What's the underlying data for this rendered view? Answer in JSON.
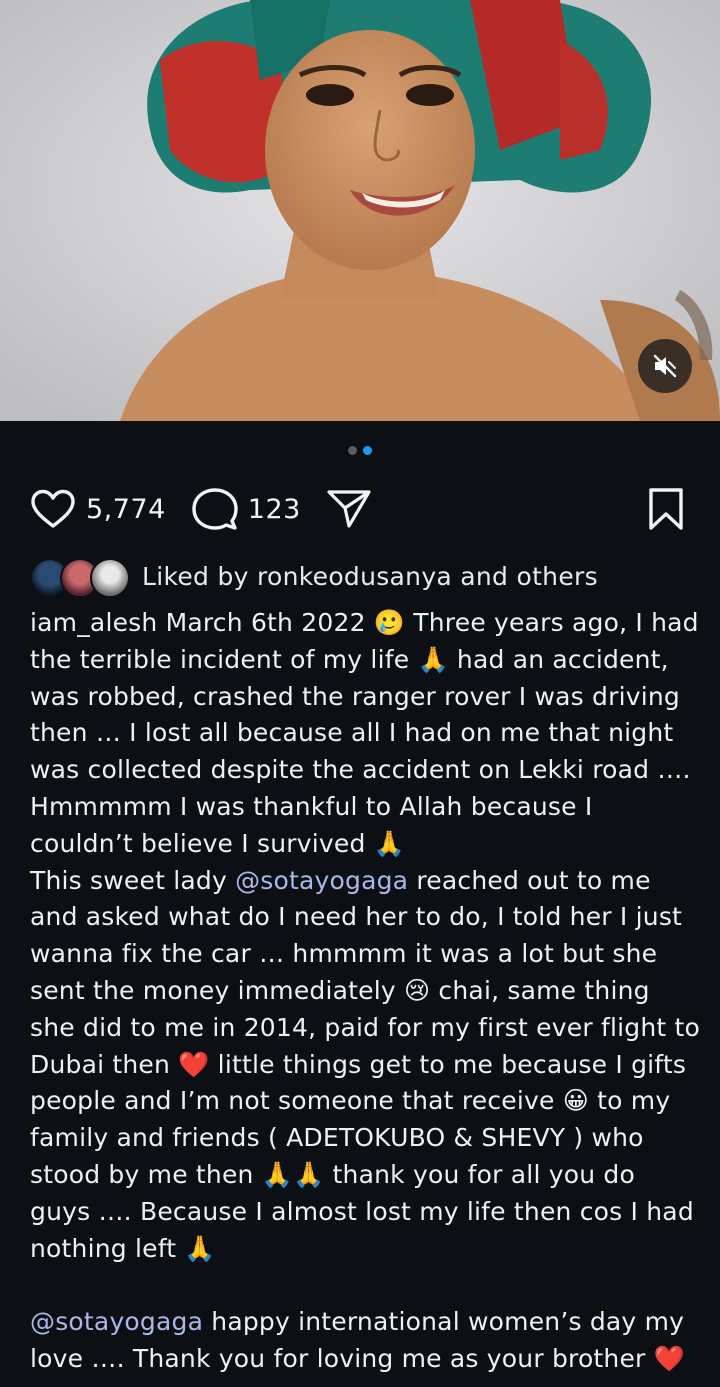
{
  "post": {
    "carousel": {
      "slides": 2,
      "active_index": 1
    },
    "media_controls": {
      "mute_icon": "speaker-muted-icon"
    },
    "likes_count": "5,774",
    "comments_count": "123",
    "liked_by": {
      "prefix": "Liked by",
      "user": "ronkeodusanya",
      "suffix": "and others"
    },
    "caption": {
      "username": "iam_alesh",
      "p1_a": "March 6th 2022 🥲 Three years ago, I had the terrible incident of my life 🙏 had an accident, was robbed, crashed the ranger rover I was driving then … I lost all because all I had on me that night was collected despite the accident on Lekki road …. Hmmmmm I was thankful to Allah because I couldn’t believe I survived 🙏",
      "p2_pre": "This sweet lady ",
      "mention": "@sotayogaga",
      "p2_post": " reached out to me and asked what do I need her to do, I told her I just wanna fix the car … hmmmm it was a lot but she sent the money immediately 😢 chai, same thing she did to me in 2014, paid for my first ever flight to Dubai then ❤️ little things get to me because I gifts people and I’m not someone that receive 😀 to my family and friends ( ADETOKUBO & SHEVY ) who stood by me then 🙏🙏 thank you for all you do guys …. Because I almost lost my life then cos I had nothing left 🙏",
      "p3_post": " happy international women’s day my love …. Thank you for loving me as your brother ❤️"
    }
  },
  "colors": {
    "background": "#0c1014",
    "text": "#f1f3f5",
    "mention": "#a9b8e8",
    "active_dot": "#1d9bf0"
  }
}
